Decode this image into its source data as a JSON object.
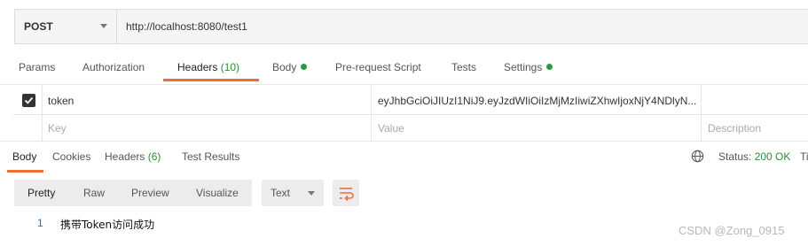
{
  "request": {
    "method": "POST",
    "url": "http://localhost:8080/test1"
  },
  "request_tabs": [
    {
      "label": "Params"
    },
    {
      "label": "Authorization"
    },
    {
      "label": "Headers",
      "count": "(10)"
    },
    {
      "label": "Body"
    },
    {
      "label": "Pre-request Script"
    },
    {
      "label": "Tests"
    },
    {
      "label": "Settings"
    }
  ],
  "headers_table": {
    "row": {
      "key": "token",
      "value": "eyJhbGciOiJIUzI1NiJ9.eyJzdWIiOiIzMjMzIiwiZXhwIjoxNjY4NDlyN..."
    },
    "placeholders": {
      "key": "Key",
      "value": "Value",
      "description": "Description"
    }
  },
  "response_tabs": [
    {
      "label": "Body"
    },
    {
      "label": "Cookies"
    },
    {
      "label": "Headers",
      "count": "(6)"
    },
    {
      "label": "Test Results"
    }
  ],
  "status": {
    "label": "Status:",
    "value": "200 OK",
    "truncated": "Ti"
  },
  "view_buttons": [
    "Pretty",
    "Raw",
    "Preview",
    "Visualize"
  ],
  "format": "Text",
  "response_body": {
    "line": "1",
    "text": "携带Token访问成功"
  },
  "watermark": "CSDN @Zong_0915",
  "colors": {
    "accent": "#f26b3a",
    "success": "#2e8b3a",
    "line_number": "#2a6fb5"
  }
}
